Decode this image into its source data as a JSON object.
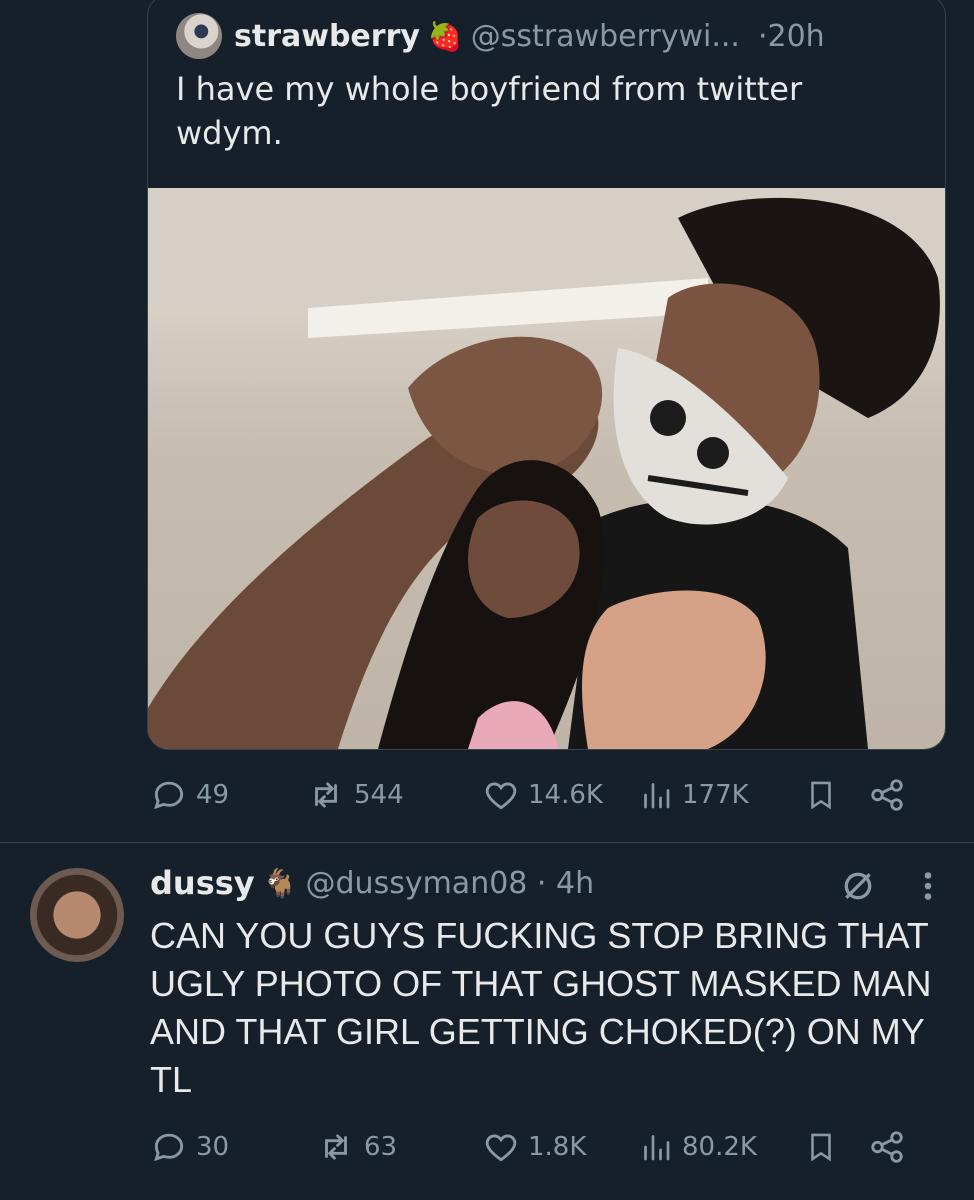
{
  "quoted_tweet": {
    "display_name": "strawberry",
    "name_emoji": "🍓",
    "handle": "@sstrawberrywi...",
    "age": "·20h",
    "text": "I have my whole boyfriend from twitter wdym.",
    "stats": {
      "replies": "49",
      "reposts": "544",
      "likes": "14.6K",
      "views": "177K"
    }
  },
  "reply_tweet": {
    "display_name": "dussy",
    "name_emoji": "🐐",
    "handle": "@dussyman08 · 4h",
    "text": "CAN YOU GUYS FUCKING STOP BRING THAT UGLY PHOTO OF THAT GHOST MASKED MAN AND THAT GIRL GETTING CHOKED(?) ON MY TL",
    "stats": {
      "replies": "30",
      "reposts": "63",
      "likes": "1.8K",
      "views": "80.2K"
    }
  },
  "colors": {
    "background": "#15202b",
    "text": "#e7e9ea",
    "muted": "#8b98a5",
    "border": "#38444d"
  }
}
